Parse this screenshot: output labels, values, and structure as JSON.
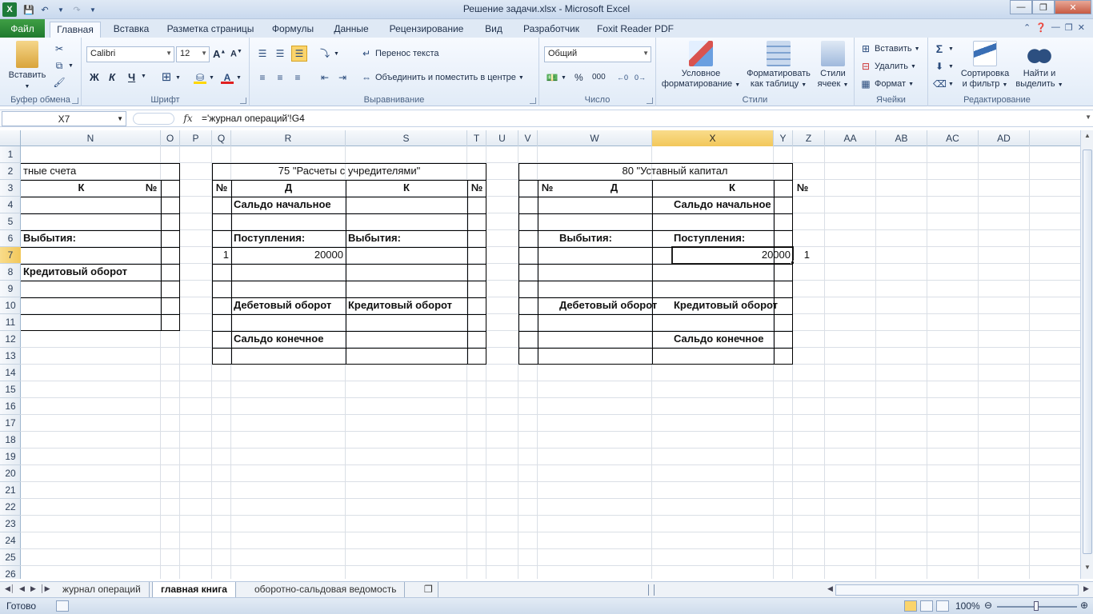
{
  "window": {
    "title": "Решение задачи.xlsx  -  Microsoft Excel"
  },
  "ribbon_tabs": {
    "file": "Файл",
    "items": [
      "Главная",
      "Вставка",
      "Разметка страницы",
      "Формулы",
      "Данные",
      "Рецензирование",
      "Вид",
      "Разработчик",
      "Foxit Reader PDF"
    ],
    "active": "Главная"
  },
  "ribbon": {
    "clipboard": {
      "label": "Буфер обмена",
      "paste": "Вставить"
    },
    "font": {
      "label": "Шрифт",
      "name": "Calibri",
      "size": "12",
      "bold": "Ж",
      "italic": "К",
      "underline": "Ч"
    },
    "alignment": {
      "label": "Выравнивание",
      "wrap": "Перенос текста",
      "merge": "Объединить и поместить в центре"
    },
    "number": {
      "label": "Число",
      "format": "Общий",
      "percent": "%",
      "thousands": "000"
    },
    "styles": {
      "label": "Стили",
      "conditional_1": "Условное",
      "conditional_2": "форматирование",
      "as_table_1": "Форматировать",
      "as_table_2": "как таблицу",
      "cell_styles_1": "Стили",
      "cell_styles_2": "ячеек"
    },
    "cells": {
      "label": "Ячейки",
      "insert": "Вставить",
      "delete": "Удалить",
      "format": "Формат"
    },
    "editing": {
      "label": "Редактирование",
      "sort_1": "Сортировка",
      "sort_2": "и фильтр",
      "find_1": "Найти и",
      "find_2": "выделить"
    }
  },
  "formula_bar": {
    "name_box": "X7",
    "fx": "fx",
    "formula": "='журнал операций'!G4"
  },
  "sheet": {
    "columns": [
      "N",
      "O",
      "P",
      "Q",
      "R",
      "S",
      "T",
      "U",
      "V",
      "W",
      "X",
      "Y",
      "Z",
      "AA",
      "AB",
      "AC",
      "AD"
    ],
    "selected_column": "X",
    "rows": [
      "1",
      "2",
      "3",
      "4",
      "5",
      "6",
      "7",
      "8",
      "9",
      "10",
      "11",
      "12",
      "13",
      "14",
      "15",
      "16",
      "17",
      "18",
      "19",
      "20",
      "21",
      "22",
      "23",
      "24",
      "25",
      "26"
    ],
    "selected_row": "7",
    "account_left": {
      "title": "тные счета",
      "col_k": "К",
      "col_no": "№",
      "outflows": "Выбытия:",
      "credit_turnover": "Кредитовый оборот"
    },
    "account_75": {
      "title": "75 \"Расчеты с учредителями\"",
      "col_no_left": "№",
      "col_d": "Д",
      "col_k": "К",
      "col_no_right": "№",
      "opening_balance": "Сальдо начальное",
      "inflows": "Поступления:",
      "outflows": "Выбытия:",
      "row7_no": "1",
      "row7_amount": "20000",
      "debit_turnover": "Дебетовый оборот",
      "credit_turnover": "Кредитовый оборот",
      "closing_balance": "Сальдо конечное"
    },
    "account_80": {
      "title": "80 \"Уставный капитал",
      "col_no_left": "№",
      "col_d": "Д",
      "col_k": "К",
      "col_no_right": "№",
      "opening_balance": "Сальдо начальное",
      "outflows": "Выбытия:",
      "inflows": "Поступления:",
      "row7_amount": "20000",
      "row7_no": "1",
      "debit_turnover": "Дебетовый оборот",
      "credit_turnover": "Кредитовый оборот",
      "closing_balance": "Сальдо конечное"
    }
  },
  "sheet_tabs": {
    "items": [
      "журнал операций",
      "главная книга",
      "оборотно-сальдовая ведомость"
    ],
    "active": "главная книга"
  },
  "status_bar": {
    "status": "Готово",
    "zoom": "100%"
  },
  "colors": {
    "file_tab": "#1f7a2e",
    "selection_header": "#f2c75a",
    "ribbon_bg": "#e1ebf7"
  }
}
